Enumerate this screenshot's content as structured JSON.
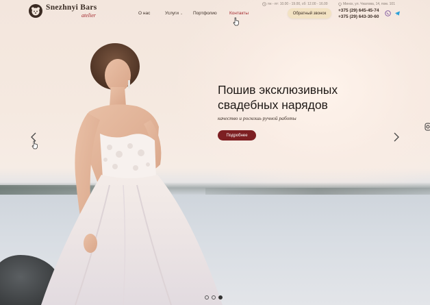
{
  "brand": {
    "name": "Snezhnyi Bars",
    "sub": "atelier",
    "logo_icon": "snow-leopard-icon"
  },
  "nav": {
    "items": [
      {
        "label": "О нас",
        "active": false,
        "dropdown": false
      },
      {
        "label": "Услуги",
        "active": false,
        "dropdown": true
      },
      {
        "label": "Портфолио",
        "active": false,
        "dropdown": false
      },
      {
        "label": "Контакты",
        "active": true,
        "dropdown": false
      }
    ]
  },
  "header": {
    "hours": "пн - пт: 10.00 - 19.00, сб: 12.00 - 16.00",
    "address": "Минск, ул. Чкалова, 14, пом. 101",
    "callback_label": "Обратный звонок",
    "phones": [
      "+375 (29) 645-45-74",
      "+375 (29) 643-30-60"
    ],
    "social": [
      "viber-icon",
      "telegram-icon"
    ]
  },
  "hero": {
    "title_line1": "Пошив эксклюзивных",
    "title_line2": "свадебных нарядов",
    "subtitle": "качество и роскошь ручной работы",
    "button_label": "Подробнее",
    "slides_total": 3,
    "slide_active": 3
  },
  "colors": {
    "accent": "#a3272d",
    "button": "#7d1f22",
    "callback_bg": "#f2e2c3",
    "text": "#1f1a17"
  }
}
